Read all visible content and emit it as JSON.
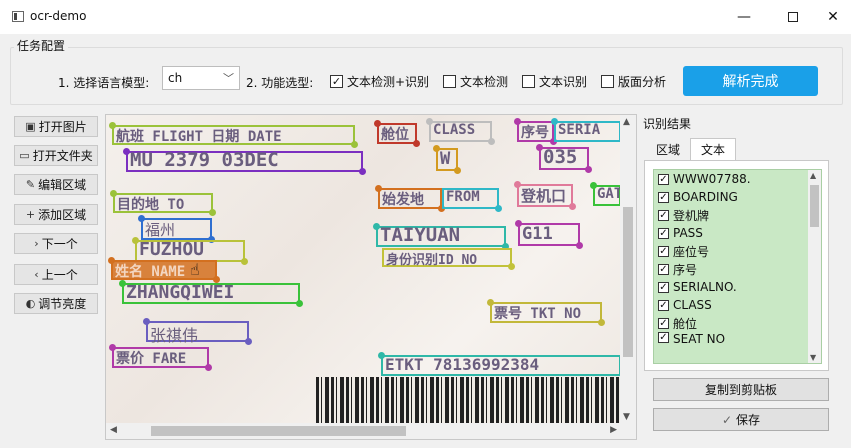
{
  "window": {
    "title": "ocr-demo",
    "min_symbol": "—",
    "close_symbol": "✕"
  },
  "config": {
    "group_title": "任务配置",
    "lang_label": "1. 选择语言模型:",
    "lang_value": "ch",
    "func_label": "2. 功能选型:",
    "options": [
      {
        "label": "文本检测+识别",
        "checked": true
      },
      {
        "label": "文本检测",
        "checked": false
      },
      {
        "label": "文本识别",
        "checked": false
      },
      {
        "label": "版面分析",
        "checked": false
      }
    ],
    "run_button": "解析完成"
  },
  "toolbar": [
    {
      "label": "打开图片",
      "icon": "image-icon",
      "glyph": "▣"
    },
    {
      "label": "打开文件夹",
      "icon": "folder-icon",
      "glyph": "▭"
    },
    {
      "label": "编辑区域",
      "icon": "pencil-icon",
      "glyph": "✎"
    },
    {
      "label": "添加区域",
      "icon": "plus-icon",
      "glyph": "+"
    },
    {
      "label": "下一个",
      "icon": "chevron-right-icon",
      "glyph": "›"
    },
    {
      "label": "上一个",
      "icon": "chevron-left-icon",
      "glyph": "‹"
    },
    {
      "label": "调节亮度",
      "icon": "brightness-icon",
      "glyph": "◐"
    }
  ],
  "image_text": [
    {
      "text": "航班 FLIGHT  日期 DATE",
      "color": "#9bc23a"
    },
    {
      "text": "舱位",
      "color": "#c0392b"
    },
    {
      "text": "CLASS",
      "color": "#bdbdbd"
    },
    {
      "text": "序号",
      "color": "#b03aa8"
    },
    {
      "text": "SERIA",
      "color": "#2fb8c7"
    },
    {
      "text": "MU 2379  03DEC",
      "color": "#7b2fc0"
    },
    {
      "text": "W",
      "color": "#d39a1f"
    },
    {
      "text": "035",
      "color": "#b03aa8"
    },
    {
      "text": "目的地  TO",
      "color": "#9bc23a"
    },
    {
      "text": "始发地",
      "color": "#d3701f"
    },
    {
      "text": "FROM",
      "color": "#2fb8c7"
    },
    {
      "text": "登机口",
      "color": "#e07a9a"
    },
    {
      "text": "GAT",
      "color": "#3ac23a"
    },
    {
      "text": "福州",
      "color": "#2f6fd0"
    },
    {
      "text": "TAIYUAN",
      "color": "#2fb8a8"
    },
    {
      "text": "G11",
      "color": "#b03aa8"
    },
    {
      "text": "FUZHOU",
      "color": "#b9c23a"
    },
    {
      "text": "身份识别ID NO",
      "color": "#c2c23a"
    },
    {
      "text": "姓名  NAME",
      "color": "#d3701f"
    },
    {
      "text": "ZHANGQIWEI",
      "color": "#3ac23a"
    },
    {
      "text": "票号 TKT NO",
      "color": "#c2b83a"
    },
    {
      "text": "张祺伟",
      "color": "#6a5ec0"
    },
    {
      "text": "票价 FARE",
      "color": "#b03aa8"
    },
    {
      "text": "ETKT 78136992384",
      "color": "#2fb8a8"
    }
  ],
  "results": {
    "title": "识别结果",
    "tabs": [
      "区域",
      "文本"
    ],
    "active_tab": "文本",
    "items": [
      "WWW07788.",
      "BOARDING",
      "登机牌",
      "PASS",
      "座位号",
      "序号",
      "SERIALNO.",
      "CLASS",
      "舱位",
      "SEAT NO"
    ],
    "copy_button": "复制到剪贴板",
    "save_button": "保存",
    "save_glyph": "✓"
  },
  "colors": {
    "accent": "#1aa0e8",
    "list_bg": "#c9e8c5"
  }
}
